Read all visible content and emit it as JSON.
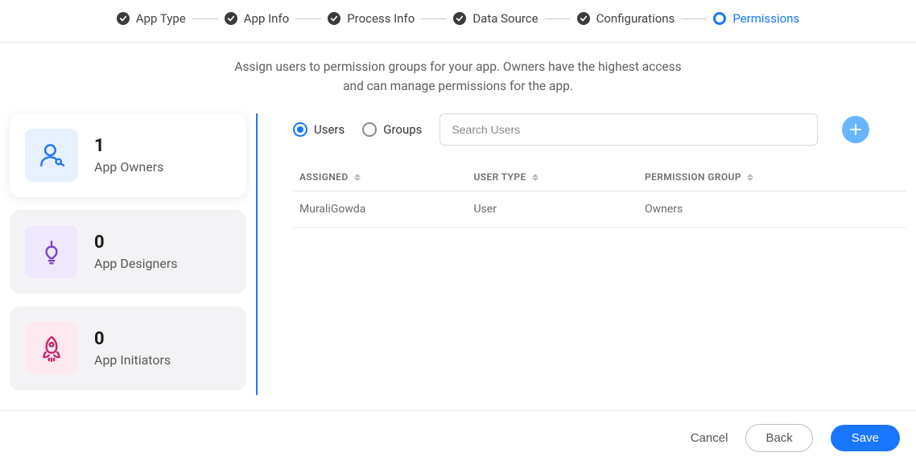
{
  "stepper": {
    "steps": [
      {
        "label": "App Type",
        "done": true
      },
      {
        "label": "App Info",
        "done": true
      },
      {
        "label": "Process Info",
        "done": true
      },
      {
        "label": "Data Source",
        "done": true
      },
      {
        "label": "Configurations",
        "done": true
      },
      {
        "label": "Permissions",
        "active": true
      }
    ]
  },
  "intro": {
    "line1": "Assign users to permission groups for your app. Owners have the highest access",
    "line2": "and can manage permissions for the app."
  },
  "cards": {
    "owners": {
      "count": "1",
      "label": "App Owners"
    },
    "designers": {
      "count": "0",
      "label": "App Designers"
    },
    "initiators": {
      "count": "0",
      "label": "App Initiators"
    }
  },
  "filter": {
    "users_label": "Users",
    "groups_label": "Groups",
    "selected": "users",
    "search_placeholder": "Search Users"
  },
  "table": {
    "headers": {
      "assigned": "ASSIGNED",
      "user_type": "USER TYPE",
      "permission_group": "PERMISSION GROUP"
    },
    "rows": [
      {
        "assigned": "MuraliGowda",
        "user_type": "User",
        "permission_group": "Owners"
      }
    ]
  },
  "footer": {
    "cancel": "Cancel",
    "back": "Back",
    "save": "Save"
  }
}
